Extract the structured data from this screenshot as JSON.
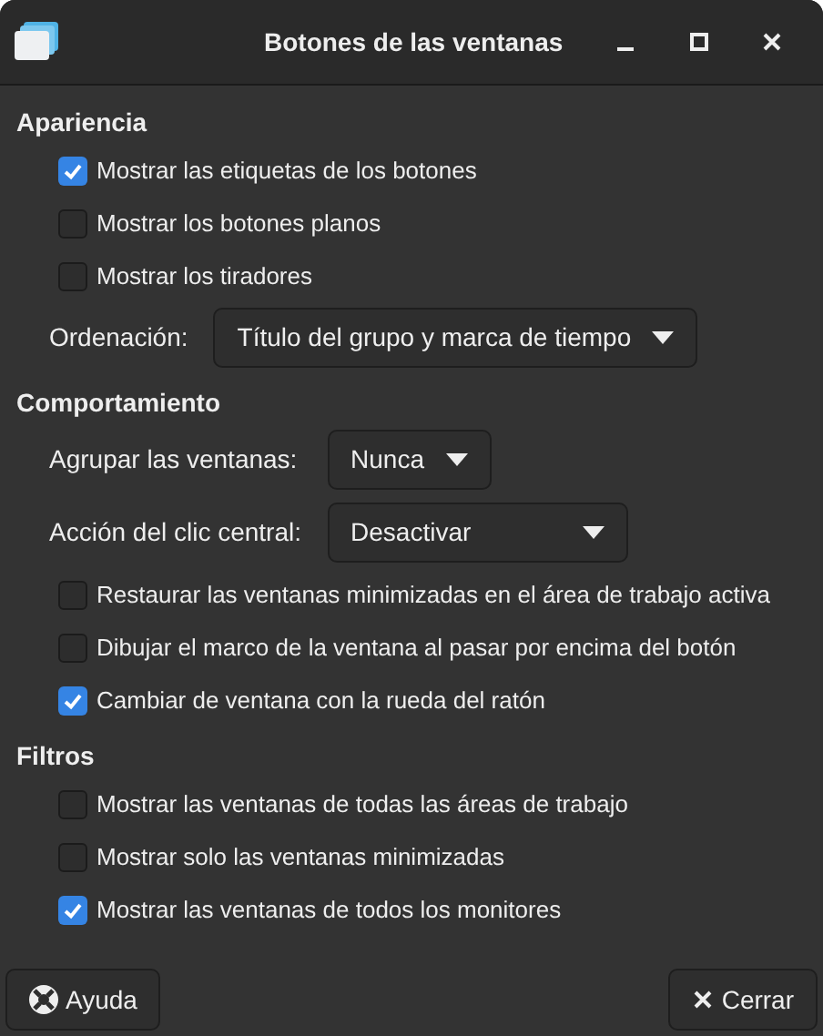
{
  "window": {
    "title": "Botones de las ventanas"
  },
  "sections": [
    {
      "title": "Apariencia",
      "items": [
        {
          "kind": "checkbox",
          "label": "Mostrar las etiquetas de los botones",
          "checked": true
        },
        {
          "kind": "checkbox",
          "label": "Mostrar los botones planos",
          "checked": false
        },
        {
          "kind": "checkbox",
          "label": "Mostrar los tiradores",
          "checked": false
        },
        {
          "kind": "dropdown",
          "label": "Ordenación:",
          "value": "Título del grupo y marca de tiempo"
        }
      ]
    },
    {
      "title": "Comportamiento",
      "items": [
        {
          "kind": "dropdown",
          "label": "Agrupar las ventanas:",
          "value": "Nunca"
        },
        {
          "kind": "dropdown",
          "label": "Acción del clic central:",
          "value": "Desactivar"
        },
        {
          "kind": "checkbox",
          "label": "Restaurar las ventanas minimizadas en el área de trabajo activa",
          "checked": false
        },
        {
          "kind": "checkbox",
          "label": "Dibujar el marco de la ventana al pasar por encima del botón",
          "checked": false
        },
        {
          "kind": "checkbox",
          "label": "Cambiar de ventana con la rueda del ratón",
          "checked": true
        }
      ]
    },
    {
      "title": "Filtros",
      "items": [
        {
          "kind": "checkbox",
          "label": "Mostrar las ventanas de todas las áreas de trabajo",
          "checked": false
        },
        {
          "kind": "checkbox",
          "label": "Mostrar solo las ventanas minimizadas",
          "checked": false
        },
        {
          "kind": "checkbox",
          "label": "Mostrar las ventanas de todos los monitores",
          "checked": true
        }
      ]
    }
  ],
  "buttons": [
    {
      "kind": "help",
      "label": "Ayuda"
    },
    {
      "kind": "close",
      "label": "Cerrar"
    }
  ]
}
